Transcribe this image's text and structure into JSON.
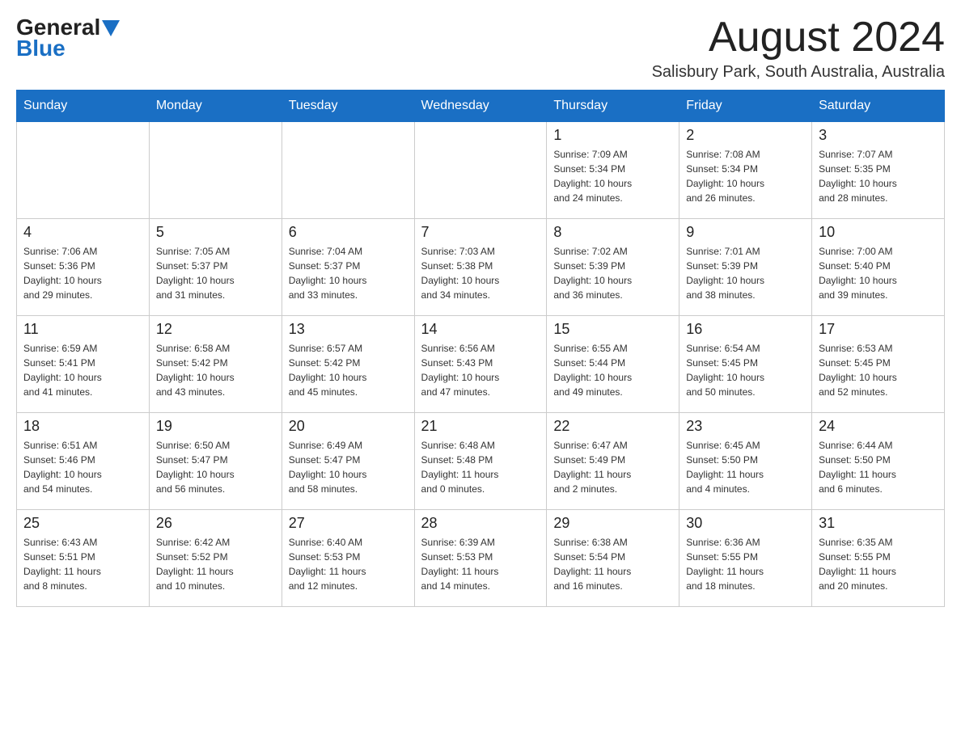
{
  "header": {
    "logo_general": "General",
    "logo_blue": "Blue",
    "month_title": "August 2024",
    "location": "Salisbury Park, South Australia, Australia"
  },
  "weekdays": [
    "Sunday",
    "Monday",
    "Tuesday",
    "Wednesday",
    "Thursday",
    "Friday",
    "Saturday"
  ],
  "weeks": [
    [
      {
        "day": "",
        "info": ""
      },
      {
        "day": "",
        "info": ""
      },
      {
        "day": "",
        "info": ""
      },
      {
        "day": "",
        "info": ""
      },
      {
        "day": "1",
        "info": "Sunrise: 7:09 AM\nSunset: 5:34 PM\nDaylight: 10 hours\nand 24 minutes."
      },
      {
        "day": "2",
        "info": "Sunrise: 7:08 AM\nSunset: 5:34 PM\nDaylight: 10 hours\nand 26 minutes."
      },
      {
        "day": "3",
        "info": "Sunrise: 7:07 AM\nSunset: 5:35 PM\nDaylight: 10 hours\nand 28 minutes."
      }
    ],
    [
      {
        "day": "4",
        "info": "Sunrise: 7:06 AM\nSunset: 5:36 PM\nDaylight: 10 hours\nand 29 minutes."
      },
      {
        "day": "5",
        "info": "Sunrise: 7:05 AM\nSunset: 5:37 PM\nDaylight: 10 hours\nand 31 minutes."
      },
      {
        "day": "6",
        "info": "Sunrise: 7:04 AM\nSunset: 5:37 PM\nDaylight: 10 hours\nand 33 minutes."
      },
      {
        "day": "7",
        "info": "Sunrise: 7:03 AM\nSunset: 5:38 PM\nDaylight: 10 hours\nand 34 minutes."
      },
      {
        "day": "8",
        "info": "Sunrise: 7:02 AM\nSunset: 5:39 PM\nDaylight: 10 hours\nand 36 minutes."
      },
      {
        "day": "9",
        "info": "Sunrise: 7:01 AM\nSunset: 5:39 PM\nDaylight: 10 hours\nand 38 minutes."
      },
      {
        "day": "10",
        "info": "Sunrise: 7:00 AM\nSunset: 5:40 PM\nDaylight: 10 hours\nand 39 minutes."
      }
    ],
    [
      {
        "day": "11",
        "info": "Sunrise: 6:59 AM\nSunset: 5:41 PM\nDaylight: 10 hours\nand 41 minutes."
      },
      {
        "day": "12",
        "info": "Sunrise: 6:58 AM\nSunset: 5:42 PM\nDaylight: 10 hours\nand 43 minutes."
      },
      {
        "day": "13",
        "info": "Sunrise: 6:57 AM\nSunset: 5:42 PM\nDaylight: 10 hours\nand 45 minutes."
      },
      {
        "day": "14",
        "info": "Sunrise: 6:56 AM\nSunset: 5:43 PM\nDaylight: 10 hours\nand 47 minutes."
      },
      {
        "day": "15",
        "info": "Sunrise: 6:55 AM\nSunset: 5:44 PM\nDaylight: 10 hours\nand 49 minutes."
      },
      {
        "day": "16",
        "info": "Sunrise: 6:54 AM\nSunset: 5:45 PM\nDaylight: 10 hours\nand 50 minutes."
      },
      {
        "day": "17",
        "info": "Sunrise: 6:53 AM\nSunset: 5:45 PM\nDaylight: 10 hours\nand 52 minutes."
      }
    ],
    [
      {
        "day": "18",
        "info": "Sunrise: 6:51 AM\nSunset: 5:46 PM\nDaylight: 10 hours\nand 54 minutes."
      },
      {
        "day": "19",
        "info": "Sunrise: 6:50 AM\nSunset: 5:47 PM\nDaylight: 10 hours\nand 56 minutes."
      },
      {
        "day": "20",
        "info": "Sunrise: 6:49 AM\nSunset: 5:47 PM\nDaylight: 10 hours\nand 58 minutes."
      },
      {
        "day": "21",
        "info": "Sunrise: 6:48 AM\nSunset: 5:48 PM\nDaylight: 11 hours\nand 0 minutes."
      },
      {
        "day": "22",
        "info": "Sunrise: 6:47 AM\nSunset: 5:49 PM\nDaylight: 11 hours\nand 2 minutes."
      },
      {
        "day": "23",
        "info": "Sunrise: 6:45 AM\nSunset: 5:50 PM\nDaylight: 11 hours\nand 4 minutes."
      },
      {
        "day": "24",
        "info": "Sunrise: 6:44 AM\nSunset: 5:50 PM\nDaylight: 11 hours\nand 6 minutes."
      }
    ],
    [
      {
        "day": "25",
        "info": "Sunrise: 6:43 AM\nSunset: 5:51 PM\nDaylight: 11 hours\nand 8 minutes."
      },
      {
        "day": "26",
        "info": "Sunrise: 6:42 AM\nSunset: 5:52 PM\nDaylight: 11 hours\nand 10 minutes."
      },
      {
        "day": "27",
        "info": "Sunrise: 6:40 AM\nSunset: 5:53 PM\nDaylight: 11 hours\nand 12 minutes."
      },
      {
        "day": "28",
        "info": "Sunrise: 6:39 AM\nSunset: 5:53 PM\nDaylight: 11 hours\nand 14 minutes."
      },
      {
        "day": "29",
        "info": "Sunrise: 6:38 AM\nSunset: 5:54 PM\nDaylight: 11 hours\nand 16 minutes."
      },
      {
        "day": "30",
        "info": "Sunrise: 6:36 AM\nSunset: 5:55 PM\nDaylight: 11 hours\nand 18 minutes."
      },
      {
        "day": "31",
        "info": "Sunrise: 6:35 AM\nSunset: 5:55 PM\nDaylight: 11 hours\nand 20 minutes."
      }
    ]
  ]
}
